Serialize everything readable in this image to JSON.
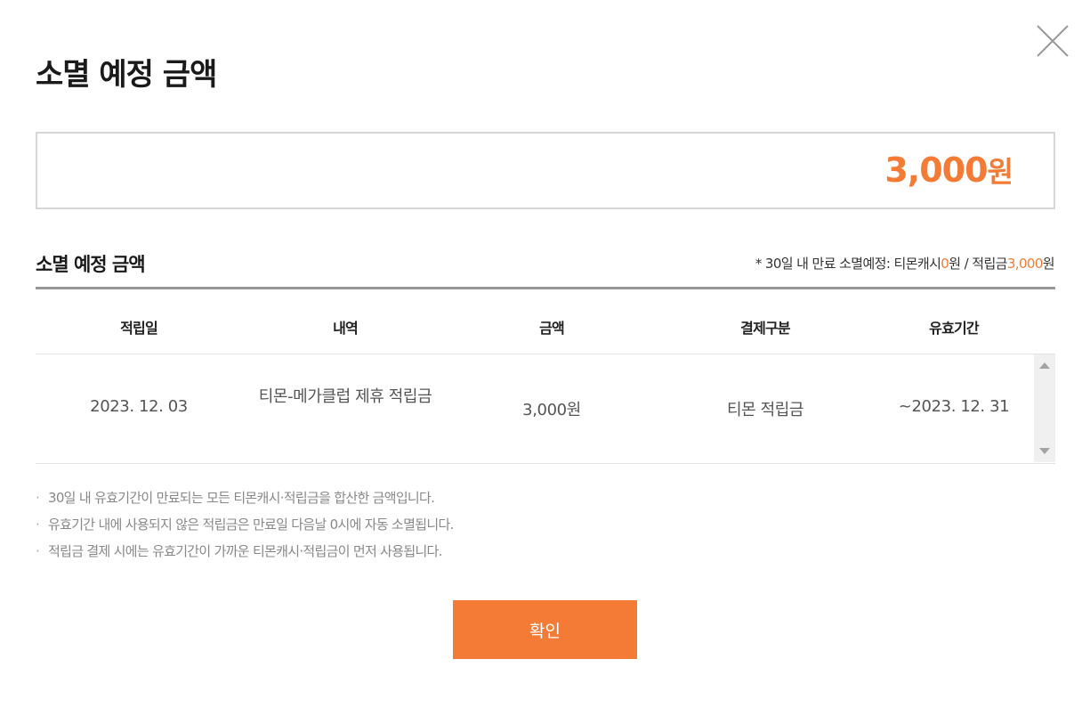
{
  "modal": {
    "title": "소멸 예정 금액",
    "close_icon": "close-icon"
  },
  "amount_box": {
    "amount": "3,000",
    "unit": "원"
  },
  "section": {
    "title": "소멸 예정 금액",
    "summary_prefix": "* 30일 내 만료 소멸예정: 티몬캐시",
    "cash_amount": "0",
    "summary_mid": "원 / 적립금",
    "point_amount": "3,000",
    "summary_suffix": "원"
  },
  "table": {
    "headers": [
      "적립일",
      "내역",
      "금액",
      "결제구분",
      "유효기간"
    ],
    "rows": [
      {
        "date": "2023. 12. 03",
        "description": "티몬-메가클럽 제휴 적립금",
        "amount": "3,000원",
        "payment_type": "티몬 적립금",
        "validity": "~2023. 12. 31"
      }
    ]
  },
  "notes": [
    "30일 내 유효기간이 만료되는 모든 티몬캐시·적립금을 합산한 금액입니다.",
    "유효기간 내에 사용되지 않은 적립금은 만료일 다음날 0시에 자동 소멸됩니다.",
    "적립금 결제 시에는 유효기간이 가까운 티몬캐시·적립금이 먼저 사용됩니다."
  ],
  "note_bullet": "·",
  "confirm_label": "확인",
  "colors": {
    "accent": "#f47b35",
    "border": "#d6d6d6",
    "table_top_border": "#999999",
    "note_text": "#888888"
  }
}
